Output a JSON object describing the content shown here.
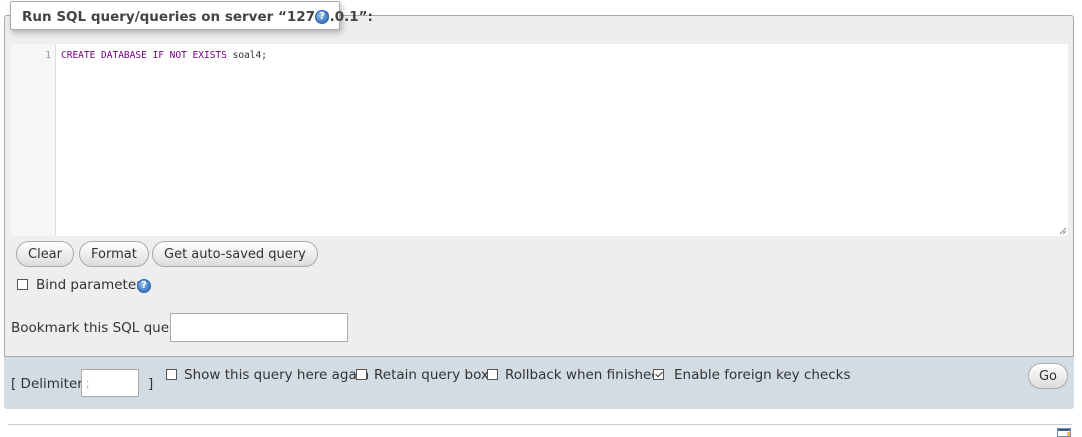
{
  "header": {
    "title": "Run SQL query/queries on server “127.0.0.1”:",
    "help_glyph": "?"
  },
  "editor": {
    "line_number": "1",
    "code_keywords": "CREATE DATABASE IF NOT EXISTS",
    "code_rest": " soal4;"
  },
  "buttons": {
    "clear": "Clear",
    "format": "Format",
    "get_autosaved": "Get auto-saved query"
  },
  "bind_parameters": {
    "label": "Bind parameters",
    "checked": false
  },
  "bookmark": {
    "label": "Bookmark this SQL query:",
    "value": ""
  },
  "footer": {
    "delimiter_open": "[ Delimiter",
    "delimiter_value": ";",
    "delimiter_close": "]",
    "show_query_again": {
      "label": "Show this query here again",
      "checked": false
    },
    "retain_query_box": {
      "label": "Retain query box",
      "checked": false
    },
    "rollback_when_finished": {
      "label": "Rollback when finished",
      "checked": false
    },
    "enable_fk_checks": {
      "label": "Enable foreign key checks",
      "checked": true
    },
    "go_label": "Go"
  },
  "colors": {
    "panel_bg": "#eeeeee",
    "footer_bg": "#d3dce3",
    "keyword": "#770088",
    "help_icon": "#4a86c9"
  },
  "icons": [
    "help-icon",
    "resize-grip-icon",
    "console-icon"
  ]
}
